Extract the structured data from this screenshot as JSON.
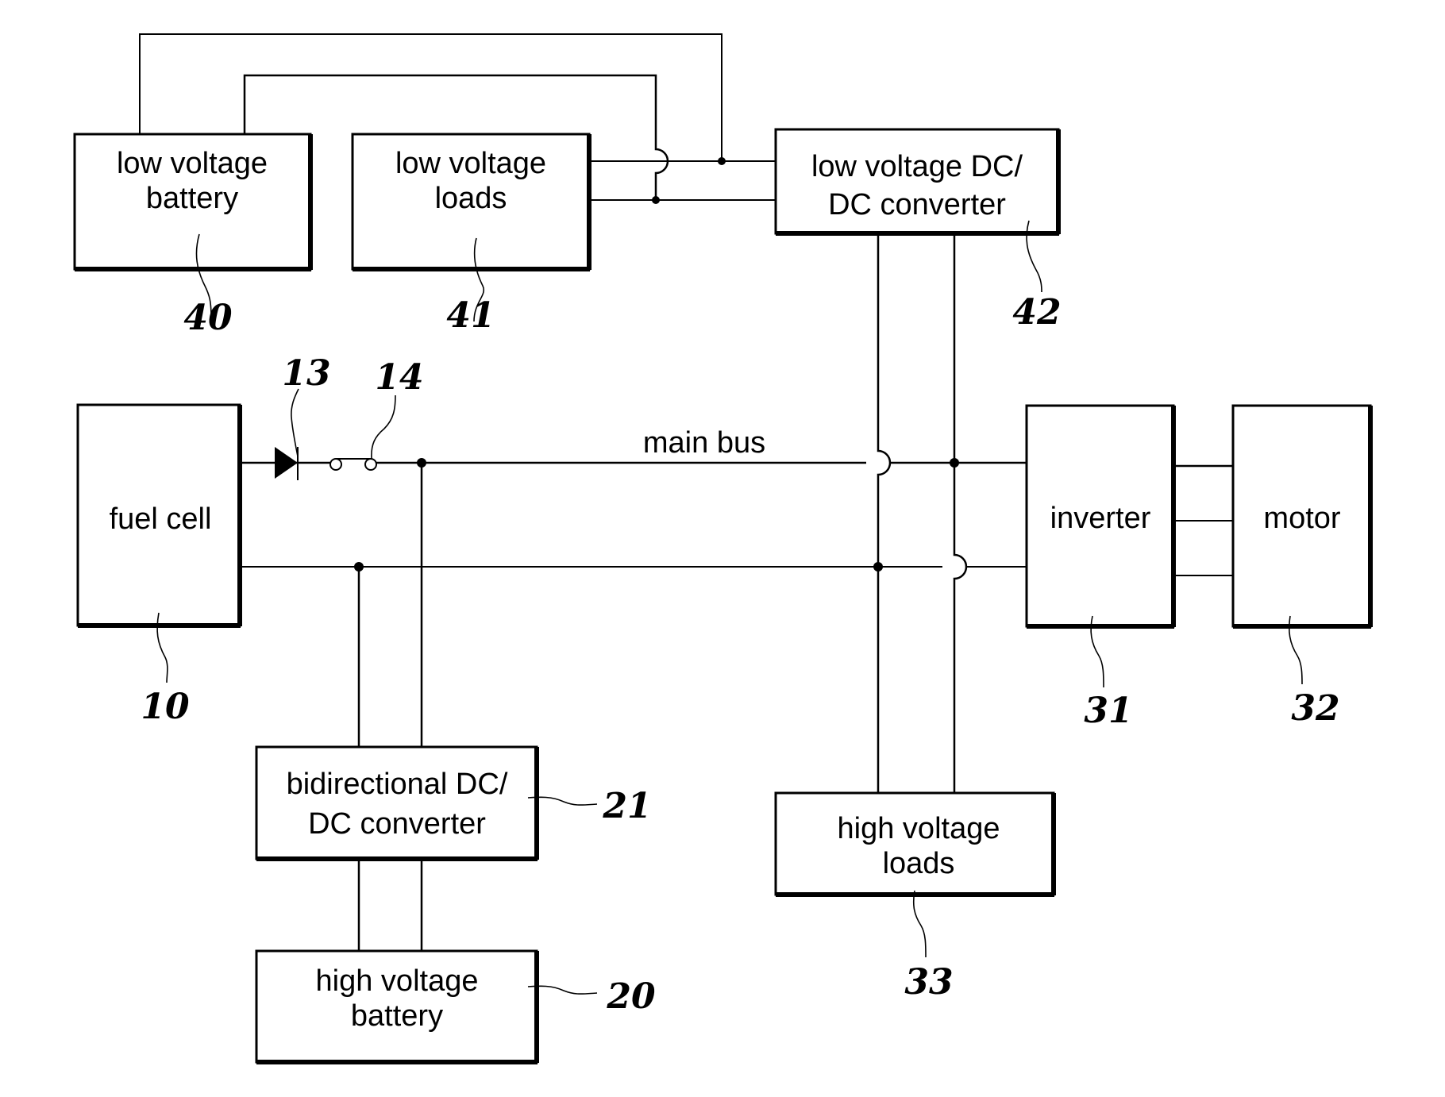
{
  "diagram": {
    "type": "power-system-block-diagram",
    "bus_label": "main bus",
    "components": {
      "low_voltage_battery": {
        "lines": [
          "low voltage",
          "battery"
        ],
        "ref": "40"
      },
      "low_voltage_loads": {
        "lines": [
          "low voltage",
          "loads"
        ],
        "ref": "41"
      },
      "low_voltage_dcdc": {
        "lines": [
          "low voltage DC/",
          "DC converter"
        ],
        "ref": "42"
      },
      "fuel_cell": {
        "lines": [
          "fuel cell"
        ],
        "ref": "10"
      },
      "diode": {
        "ref": "13"
      },
      "fuse": {
        "ref": "14"
      },
      "inverter": {
        "lines": [
          "inverter"
        ],
        "ref": "31"
      },
      "motor": {
        "lines": [
          "motor"
        ],
        "ref": "32"
      },
      "bidirectional_dcdc": {
        "lines": [
          "bidirectional DC/",
          "DC converter"
        ],
        "ref": "21"
      },
      "high_voltage_battery": {
        "lines": [
          "high voltage",
          "battery"
        ],
        "ref": "20"
      },
      "high_voltage_loads": {
        "lines": [
          "high voltage",
          "loads"
        ],
        "ref": "33"
      }
    },
    "connections": [
      [
        "fuel_cell",
        "diode"
      ],
      [
        "diode",
        "fuse"
      ],
      [
        "fuse",
        "main_bus"
      ],
      [
        "main_bus",
        "bidirectional_dcdc"
      ],
      [
        "lower_bus",
        "bidirectional_dcdc"
      ],
      [
        "bidirectional_dcdc",
        "high_voltage_battery"
      ],
      [
        "main_bus",
        "inverter"
      ],
      [
        "lower_bus",
        "inverter"
      ],
      [
        "inverter",
        "motor"
      ],
      [
        "low_voltage_dcdc",
        "main_bus"
      ],
      [
        "low_voltage_dcdc",
        "lower_bus"
      ],
      [
        "low_voltage_dcdc",
        "high_voltage_loads"
      ],
      [
        "low_voltage_dcdc",
        "low_voltage_loads"
      ],
      [
        "low_voltage_dcdc",
        "low_voltage_battery"
      ]
    ]
  }
}
